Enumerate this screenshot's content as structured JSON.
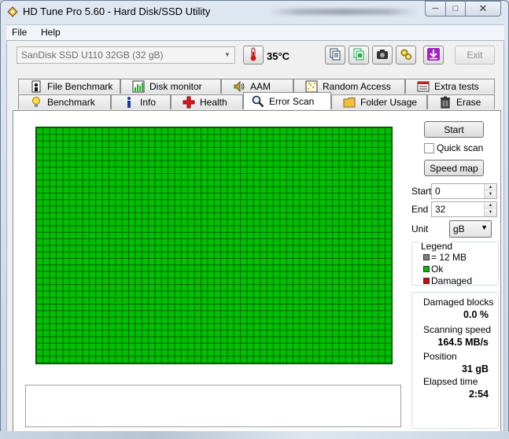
{
  "window": {
    "title": "HD Tune Pro 5.60 - Hard Disk/SSD Utility",
    "min_glyph": "─",
    "max_glyph": "□",
    "close_glyph": "✕"
  },
  "menu": {
    "file": "File",
    "help": "Help"
  },
  "toolbar": {
    "drive": "SanDisk SSD U110 32GB (32 gB)",
    "temperature": "35°C",
    "exit_label": "Exit",
    "icons": [
      "copy-text-icon",
      "copy-info-icon",
      "screenshot-camera-icon",
      "options-gear-icon",
      "save-download-icon"
    ]
  },
  "tabs": {
    "row1": [
      {
        "label": "File Benchmark",
        "icon": "file-benchmark-icon"
      },
      {
        "label": "Disk monitor",
        "icon": "disk-monitor-icon"
      },
      {
        "label": "AAM",
        "icon": "speaker-icon"
      },
      {
        "label": "Random Access",
        "icon": "random-access-icon"
      },
      {
        "label": "Extra tests",
        "icon": "extra-tests-icon"
      }
    ],
    "row2": [
      {
        "label": "Benchmark",
        "icon": "lightbulb-icon"
      },
      {
        "label": "Info",
        "icon": "info-icon"
      },
      {
        "label": "Health",
        "icon": "health-cross-icon"
      },
      {
        "label": "Error Scan",
        "icon": "magnifier-icon",
        "active": true
      },
      {
        "label": "Folder Usage",
        "icon": "folder-icon"
      },
      {
        "label": "Erase",
        "icon": "trash-icon"
      }
    ]
  },
  "error_scan": {
    "start_button": "Start",
    "quick_scan_label": "Quick scan",
    "quick_scan_checked": false,
    "speed_map_button": "Speed map",
    "start_label": "Start",
    "start_value": "0",
    "end_label": "End",
    "end_value": "32",
    "unit_label": "Unit",
    "unit_value": "gB",
    "legend": {
      "title": "Legend",
      "items": [
        {
          "label": "= 12 MB",
          "color": "#808080"
        },
        {
          "label": "Ok",
          "color": "#00c000"
        },
        {
          "label": "Damaged",
          "color": "#e00000"
        }
      ]
    },
    "stats": {
      "damaged_blocks_label": "Damaged blocks",
      "damaged_blocks_value": "0.0 %",
      "scanning_speed_label": "Scanning speed",
      "scanning_speed_value": "164.5 MB/s",
      "position_label": "Position",
      "position_value": "31 gB",
      "elapsed_label": "Elapsed time",
      "elapsed_value": "2:54"
    },
    "grid_color_ok": "#00c000",
    "log_text": ""
  }
}
